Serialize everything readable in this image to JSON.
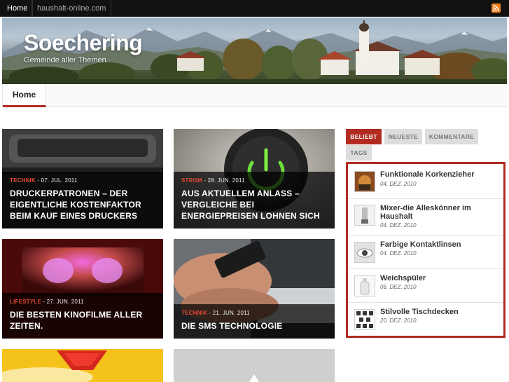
{
  "topbar": {
    "links": [
      "Home",
      "haushalt-online.com"
    ],
    "rss_icon": "rss-icon"
  },
  "header": {
    "title": "Soechering",
    "tagline": "Gemeinde aller Themen"
  },
  "nav": {
    "items": [
      "Home"
    ]
  },
  "posts": [
    {
      "category": "TECHNIK",
      "date": " - 07. JUL. 2011",
      "title": "DRUCKERPATRONEN – DER EIGENTLICHE KOSTENFAKTOR BEIM KAUF EINES DRUCKERS"
    },
    {
      "category": "STROM",
      "date": " - 28. JUN. 2011",
      "title": "AUS AKTUELLEM ANLASS – VERGLEICHE BEI ENERGIEPREISEN LOHNEN SICH"
    },
    {
      "category": "LIFESTYLE",
      "date": " - 27. JUN. 2011",
      "title": "DIE BESTEN KINOFILME ALLER ZEITEN."
    },
    {
      "category": "TECHNIK",
      "date": " - 21. JUN. 2011",
      "title": "DIE SMS TECHNOLOGIE"
    }
  ],
  "sidebar": {
    "tabs": [
      "BELIEBT",
      "NEUESTE",
      "KOMMENTARE",
      "TAGS"
    ],
    "items": [
      {
        "title": "Funktionale Korkenzieher",
        "date": "04. DEZ. 2010"
      },
      {
        "title": "Mixer-die Alleskönner im Haushalt",
        "date": "04. DEZ. 2010"
      },
      {
        "title": "Farbige Kontaktlinsen",
        "date": "04. DEZ. 2010"
      },
      {
        "title": "Weichspüler",
        "date": "06. DEZ. 2010"
      },
      {
        "title": "Stilvolle Tischdecken",
        "date": "20. DEZ. 2010"
      }
    ]
  },
  "colors": {
    "accent": "#b22b20",
    "category": "#e04a35",
    "topbar": "#111111"
  }
}
